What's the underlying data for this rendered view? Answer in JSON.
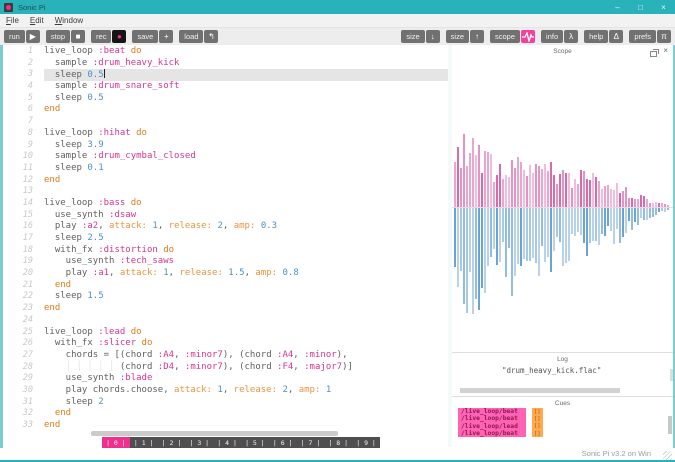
{
  "window": {
    "title": "Sonic Pi",
    "controls": [
      {
        "name": "minimize",
        "glyph": "–"
      },
      {
        "name": "maximize",
        "glyph": "□"
      },
      {
        "name": "close",
        "glyph": "×"
      }
    ]
  },
  "colors": {
    "titlebar_teal": "#29b2ba",
    "accent_pink": "#f0308e",
    "toolbar_button_gray": "#717171"
  },
  "menu": {
    "items": [
      {
        "label": "File"
      },
      {
        "label": "Edit"
      },
      {
        "label": "Window"
      }
    ]
  },
  "toolbar": {
    "left": [
      {
        "name": "run",
        "label": "run",
        "icon": "play-icon",
        "glyph": "▶"
      },
      {
        "name": "stop",
        "label": "stop",
        "icon": "stop-icon",
        "glyph": "■"
      },
      {
        "name": "rec",
        "label": "rec",
        "icon": "record-icon",
        "glyph": "●",
        "icon_bg": "#151515",
        "glyph_color": "#f0308e"
      },
      {
        "name": "save",
        "label": "save",
        "icon": "save-plus-icon",
        "glyph": "+"
      },
      {
        "name": "load",
        "label": "load",
        "icon": "load-arrow-icon",
        "glyph": "↰"
      }
    ],
    "right": [
      {
        "name": "size-down",
        "label": "size",
        "icon": "text-smaller-icon",
        "glyph": "↓"
      },
      {
        "name": "size-up",
        "label": "size",
        "icon": "text-larger-icon",
        "glyph": "↑"
      },
      {
        "name": "scope",
        "label": "scope",
        "icon": "waveform-icon",
        "glyph": "",
        "icon_bg": "#f5419b"
      },
      {
        "name": "info",
        "label": "info",
        "icon": "lambda-icon",
        "glyph": "λ"
      },
      {
        "name": "help",
        "label": "help",
        "icon": "delta-icon",
        "glyph": "Δ"
      },
      {
        "name": "prefs",
        "label": "prefs",
        "icon": "pi-icon",
        "glyph": "π"
      }
    ]
  },
  "editor": {
    "active_line": 3,
    "lines": [
      {
        "n": 1,
        "tokens": [
          [
            "d",
            "live_loop "
          ],
          [
            "s",
            ":beat"
          ],
          [
            "k",
            " do"
          ]
        ]
      },
      {
        "n": 2,
        "tokens": [
          [
            "d",
            "  sample "
          ],
          [
            "s",
            ":drum_heavy_kick"
          ]
        ]
      },
      {
        "n": 3,
        "cursor": true,
        "tokens": [
          [
            "d",
            "  sleep "
          ],
          [
            "n",
            "0.5"
          ]
        ]
      },
      {
        "n": 4,
        "tokens": [
          [
            "d",
            "  sample "
          ],
          [
            "s",
            ":drum_snare_soft"
          ]
        ]
      },
      {
        "n": 5,
        "tokens": [
          [
            "d",
            "  sleep "
          ],
          [
            "n",
            "0.5"
          ]
        ]
      },
      {
        "n": 6,
        "tokens": [
          [
            "k",
            "end"
          ]
        ]
      },
      {
        "n": 7,
        "tokens": []
      },
      {
        "n": 8,
        "tokens": [
          [
            "d",
            "live_loop "
          ],
          [
            "s",
            ":hihat"
          ],
          [
            "k",
            " do"
          ]
        ]
      },
      {
        "n": 9,
        "tokens": [
          [
            "d",
            "  sleep "
          ],
          [
            "n",
            "3.9"
          ]
        ]
      },
      {
        "n": 10,
        "tokens": [
          [
            "d",
            "  sample "
          ],
          [
            "s",
            ":drum_cymbal_closed"
          ]
        ]
      },
      {
        "n": 11,
        "tokens": [
          [
            "d",
            "  sleep "
          ],
          [
            "n",
            "0.1"
          ]
        ]
      },
      {
        "n": 12,
        "tokens": [
          [
            "k",
            "end"
          ]
        ]
      },
      {
        "n": 13,
        "tokens": []
      },
      {
        "n": 14,
        "tokens": [
          [
            "d",
            "live_loop "
          ],
          [
            "s",
            ":bass"
          ],
          [
            "k",
            " do"
          ]
        ]
      },
      {
        "n": 15,
        "tokens": [
          [
            "d",
            "  use_synth "
          ],
          [
            "s",
            ":dsaw"
          ]
        ]
      },
      {
        "n": 16,
        "tokens": [
          [
            "d",
            "  play "
          ],
          [
            "s",
            ":a2"
          ],
          [
            "d",
            ", "
          ],
          [
            "p",
            "attack:"
          ],
          [
            "d",
            " "
          ],
          [
            "n",
            "1"
          ],
          [
            "d",
            ", "
          ],
          [
            "p",
            "release:"
          ],
          [
            "d",
            " "
          ],
          [
            "n",
            "2"
          ],
          [
            "d",
            ", "
          ],
          [
            "p",
            "amp:"
          ],
          [
            "d",
            " "
          ],
          [
            "n",
            "0.3"
          ]
        ]
      },
      {
        "n": 17,
        "tokens": [
          [
            "d",
            "  sleep "
          ],
          [
            "n",
            "2.5"
          ]
        ]
      },
      {
        "n": 18,
        "tokens": [
          [
            "d",
            "  with_fx "
          ],
          [
            "s",
            ":distortion"
          ],
          [
            "k",
            " do"
          ]
        ]
      },
      {
        "n": 19,
        "tokens": [
          [
            "d",
            "    use_synth "
          ],
          [
            "s",
            ":tech_saws"
          ]
        ]
      },
      {
        "n": 20,
        "tokens": [
          [
            "d",
            "    play "
          ],
          [
            "s",
            ":a1"
          ],
          [
            "d",
            ", "
          ],
          [
            "p",
            "attack:"
          ],
          [
            "d",
            " "
          ],
          [
            "n",
            "1"
          ],
          [
            "d",
            ", "
          ],
          [
            "p",
            "release:"
          ],
          [
            "d",
            " "
          ],
          [
            "n",
            "1.5"
          ],
          [
            "d",
            ", "
          ],
          [
            "p",
            "amp:"
          ],
          [
            "d",
            " "
          ],
          [
            "n",
            "0.8"
          ]
        ]
      },
      {
        "n": 21,
        "tokens": [
          [
            "k",
            "  end"
          ]
        ]
      },
      {
        "n": 22,
        "tokens": [
          [
            "d",
            "  sleep "
          ],
          [
            "n",
            "1.5"
          ]
        ]
      },
      {
        "n": 23,
        "tokens": [
          [
            "k",
            "end"
          ]
        ]
      },
      {
        "n": 24,
        "tokens": []
      },
      {
        "n": 25,
        "tokens": [
          [
            "d",
            "live_loop "
          ],
          [
            "s",
            ":lead"
          ],
          [
            "k",
            " do"
          ]
        ]
      },
      {
        "n": 26,
        "tokens": [
          [
            "d",
            "  with_fx "
          ],
          [
            "s",
            ":slicer"
          ],
          [
            "k",
            " do"
          ]
        ]
      },
      {
        "n": 27,
        "tokens": [
          [
            "d",
            "    chords = [(chord "
          ],
          [
            "s",
            ":A4"
          ],
          [
            "d",
            ", "
          ],
          [
            "s",
            ":minor7"
          ],
          [
            "d",
            "), (chord "
          ],
          [
            "s",
            ":A4"
          ],
          [
            "d",
            ", "
          ],
          [
            "s",
            ":minor"
          ],
          [
            "d",
            "),"
          ]
        ]
      },
      {
        "n": 28,
        "tokens": [
          [
            "g",
            "    │ │ │ │ │ "
          ],
          [
            "d",
            "(chord "
          ],
          [
            "s",
            ":D4"
          ],
          [
            "d",
            ", "
          ],
          [
            "s",
            ":minor7"
          ],
          [
            "d",
            "), (chord "
          ],
          [
            "s",
            ":F4"
          ],
          [
            "d",
            ", "
          ],
          [
            "s",
            ":major7"
          ],
          [
            "d",
            ")]"
          ]
        ]
      },
      {
        "n": 29,
        "tokens": [
          [
            "d",
            "    use_synth "
          ],
          [
            "s",
            ":blade"
          ]
        ]
      },
      {
        "n": 30,
        "tokens": [
          [
            "d",
            "    play chords.choose, "
          ],
          [
            "p",
            "attack:"
          ],
          [
            "d",
            " "
          ],
          [
            "n",
            "1"
          ],
          [
            "d",
            ", "
          ],
          [
            "p",
            "release:"
          ],
          [
            "d",
            " "
          ],
          [
            "n",
            "2"
          ],
          [
            "d",
            ", "
          ],
          [
            "p",
            "amp:"
          ],
          [
            "d",
            " "
          ],
          [
            "n",
            "1"
          ]
        ]
      },
      {
        "n": 31,
        "tokens": [
          [
            "d",
            "    sleep "
          ],
          [
            "n",
            "2"
          ]
        ]
      },
      {
        "n": 32,
        "tokens": [
          [
            "k",
            "  end"
          ]
        ]
      },
      {
        "n": 33,
        "tokens": [
          [
            "k",
            "end"
          ]
        ]
      }
    ],
    "tabs": [
      "| 0 |",
      "| 1 |",
      "| 2 |",
      "| 3 |",
      "| 4 |",
      "| 5 |",
      "| 6 |",
      "| 7 |",
      "| 8 |",
      "| 9 |"
    ],
    "active_tab": 0
  },
  "scope": {
    "title": "Scope",
    "bar_count": 72,
    "envelope_top": [
      58,
      88,
      76,
      86,
      62,
      54,
      46,
      64,
      58,
      50,
      44,
      55,
      47,
      40,
      46,
      30,
      40,
      42,
      30,
      25,
      31,
      27,
      19,
      15,
      11,
      8,
      5,
      2
    ],
    "envelope_bottom": [
      80,
      120,
      104,
      118,
      86,
      76,
      66,
      90,
      82,
      72,
      64,
      78,
      68,
      56,
      64,
      44,
      56,
      58,
      42,
      36,
      44,
      38,
      28,
      22,
      16,
      12,
      8,
      3
    ],
    "left_channel_colors": [
      "#f2bcdc",
      "#e393c4",
      "#d86aad",
      "#eba6cf"
    ],
    "right_channel_colors": [
      "#b8d2ec",
      "#92bce2",
      "#6ba3d6",
      "#a8c8e8"
    ]
  },
  "log": {
    "title": "Log",
    "entries": [
      "\"drum_heavy_kick.flac\""
    ]
  },
  "cues": {
    "title": "Cues",
    "entries": [
      {
        "path": "/live_loop/beat",
        "args": "[]"
      },
      {
        "path": "/live_loop/beat",
        "args": "[]"
      },
      {
        "path": "/live_loop/lead",
        "args": "[]"
      },
      {
        "path": "/live_loop/beat",
        "args": "[]"
      }
    ]
  },
  "statusbar": {
    "text": "Sonic Pi v3.2 on Win"
  }
}
